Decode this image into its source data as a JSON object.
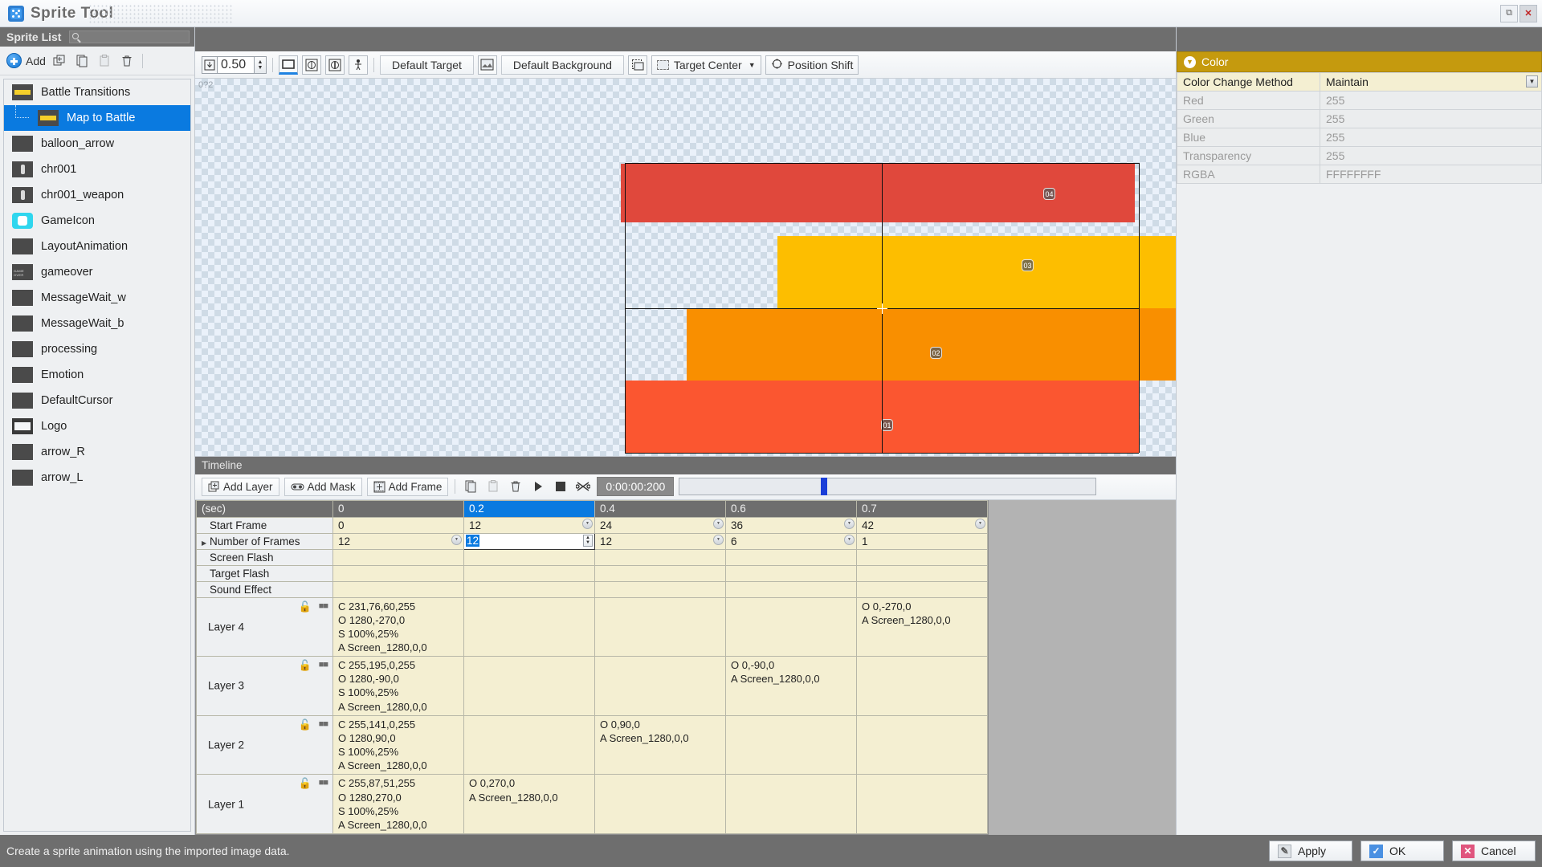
{
  "window": {
    "title": "Sprite Tool",
    "icon": "dice-icon",
    "buttons": {
      "restore": "restore-icon",
      "close": "close-icon"
    }
  },
  "sidebar": {
    "header": "Sprite List",
    "search_placeholder": "",
    "toolbar": {
      "add_label": "Add",
      "icons": [
        "duplicate-icon",
        "copy-icon",
        "paste-icon",
        "delete-icon"
      ]
    },
    "items": [
      {
        "label": "Battle Transitions",
        "thumb": "battle-transitions-thumb",
        "depth": 0,
        "selected": false
      },
      {
        "label": "Map to Battle",
        "thumb": "map-to-battle-thumb",
        "depth": 1,
        "selected": true
      },
      {
        "label": "balloon_arrow",
        "thumb": "blank-thumb",
        "depth": 0,
        "selected": false
      },
      {
        "label": "chr001",
        "thumb": "character-thumb",
        "depth": 0,
        "selected": false
      },
      {
        "label": "chr001_weapon",
        "thumb": "character-thumb",
        "depth": 0,
        "selected": false
      },
      {
        "label": "GameIcon",
        "thumb": "game-icon-thumb",
        "depth": 0,
        "selected": false
      },
      {
        "label": "LayoutAnimation",
        "thumb": "blank-thumb",
        "depth": 0,
        "selected": false
      },
      {
        "label": "gameover",
        "thumb": "gameover-thumb",
        "depth": 0,
        "selected": false
      },
      {
        "label": "MessageWait_w",
        "thumb": "blank-thumb",
        "depth": 0,
        "selected": false
      },
      {
        "label": "MessageWait_b",
        "thumb": "blank-thumb",
        "depth": 0,
        "selected": false
      },
      {
        "label": "processing",
        "thumb": "blank-thumb",
        "depth": 0,
        "selected": false
      },
      {
        "label": "Emotion",
        "thumb": "blank-thumb",
        "depth": 0,
        "selected": false
      },
      {
        "label": "DefaultCursor",
        "thumb": "blank-thumb",
        "depth": 0,
        "selected": false
      },
      {
        "label": "Logo",
        "thumb": "logo-thumb",
        "depth": 0,
        "selected": false
      },
      {
        "label": "arrow_R",
        "thumb": "blank-thumb",
        "depth": 0,
        "selected": false
      },
      {
        "label": "arrow_L",
        "thumb": "blank-thumb",
        "depth": 0,
        "selected": false
      }
    ]
  },
  "canvas_toolbar": {
    "zoom_value": "0.50",
    "fit_icon": "fit-to-window-icon",
    "view_icons": [
      "screen-frame-icon",
      "grid-a-icon",
      "grid-b-icon",
      "actor-icon"
    ],
    "default_target_label": "Default Target",
    "background_icon": "background-image-icon",
    "default_background_label": "Default Background",
    "anchor_icon": "anchor-box-icon",
    "target_center_label": "Target Center",
    "position_shift_label": "Position Shift",
    "position_shift_icon": "move-handle-icon"
  },
  "canvas": {
    "ruler_label": "0?2",
    "layers": [
      {
        "badge": "04",
        "color": "#e0483c"
      },
      {
        "badge": "03",
        "color": "#fdbe00"
      },
      {
        "badge": "02",
        "color": "#f98f00"
      },
      {
        "badge": "01",
        "color": "#fb5630"
      }
    ]
  },
  "timeline": {
    "header": "Timeline",
    "toolbar": {
      "add_layer": "Add Layer",
      "add_mask": "Add Mask",
      "add_frame": "Add Frame",
      "copy_icon": "copy-icon",
      "paste_icon": "paste-icon",
      "delete_icon": "delete-icon",
      "play_icon": "play-icon",
      "stop_icon": "stop-icon",
      "loop_icon": "loop-icon",
      "time_display": "0:00:00:200"
    },
    "columns": [
      {
        "label": "(sec)",
        "selected": false
      },
      {
        "label": "0",
        "selected": false
      },
      {
        "label": "0.2",
        "selected": true
      },
      {
        "label": "0.4",
        "selected": false
      },
      {
        "label": "0.6",
        "selected": false
      },
      {
        "label": "0.7",
        "selected": false
      }
    ],
    "property_rows": [
      {
        "name": "Start Frame",
        "expandable": false,
        "values": [
          "0",
          "12",
          "24",
          "36",
          "42"
        ],
        "steppers": [
          false,
          true,
          true,
          true,
          true
        ]
      },
      {
        "name": "Number of Frames",
        "expandable": true,
        "values": [
          "12",
          "12",
          "12",
          "6",
          "1"
        ],
        "steppers": [
          true,
          false,
          true,
          true,
          false
        ],
        "editing_index": 1
      },
      {
        "name": "Screen Flash",
        "expandable": false,
        "values": [
          "",
          "",
          "",
          "",
          ""
        ],
        "steppers": [
          false,
          false,
          false,
          false,
          false
        ]
      },
      {
        "name": "Target Flash",
        "expandable": false,
        "values": [
          "",
          "",
          "",
          "",
          ""
        ],
        "steppers": [
          false,
          false,
          false,
          false,
          false
        ]
      },
      {
        "name": "Sound Effect",
        "expandable": false,
        "values": [
          "",
          "",
          "",
          "",
          ""
        ],
        "steppers": [
          false,
          false,
          false,
          false,
          false
        ]
      }
    ],
    "layer_rows": [
      {
        "name": "Layer 4",
        "lock_icon": "unlock-icon",
        "link_icon": "link-icon",
        "cells": [
          "C 231,76,60,255\nO 1280,-270,0\nS 100%,25%\nA Screen_1280,0,0",
          "",
          "",
          "",
          "O 0,-270,0\nA Screen_1280,0,0"
        ]
      },
      {
        "name": "Layer 3",
        "lock_icon": "unlock-icon",
        "link_icon": "link-icon",
        "cells": [
          "C 255,195,0,255\nO 1280,-90,0\nS 100%,25%\nA Screen_1280,0,0",
          "",
          "",
          "O 0,-90,0\nA Screen_1280,0,0",
          ""
        ]
      },
      {
        "name": "Layer 2",
        "lock_icon": "unlock-icon",
        "link_icon": "link-icon",
        "cells": [
          "C 255,141,0,255\nO 1280,90,0\nS 100%,25%\nA Screen_1280,0,0",
          "",
          "O 0,90,0\nA Screen_1280,0,0",
          "",
          ""
        ]
      },
      {
        "name": "Layer 1",
        "lock_icon": "unlock-icon",
        "link_icon": "link-icon",
        "cells": [
          "C 255,87,51,255\nO 1280,270,0\nS 100%,25%\nA Screen_1280,0,0",
          "O 0,270,0\nA Screen_1280,0,0",
          "",
          "",
          ""
        ]
      }
    ]
  },
  "color_panel": {
    "title": "Color",
    "collapse_icon": "chevron-down-icon",
    "rows": [
      {
        "name": "Color Change Method",
        "value": "Maintain",
        "active": true,
        "dropdown": true
      },
      {
        "name": "Red",
        "value": "255",
        "active": false,
        "dropdown": false
      },
      {
        "name": "Green",
        "value": "255",
        "active": false,
        "dropdown": false
      },
      {
        "name": "Blue",
        "value": "255",
        "active": false,
        "dropdown": false
      },
      {
        "name": "Transparency",
        "value": "255",
        "active": false,
        "dropdown": false
      },
      {
        "name": "RGBA",
        "value": "FFFFFFFF",
        "active": false,
        "dropdown": false
      }
    ]
  },
  "statusbar": {
    "message": "Create a sprite animation using the imported image data.",
    "buttons": [
      {
        "label": "Apply",
        "icon": "apply-icon"
      },
      {
        "label": "OK",
        "icon": "check-icon"
      },
      {
        "label": "Cancel",
        "icon": "cross-icon"
      }
    ]
  }
}
